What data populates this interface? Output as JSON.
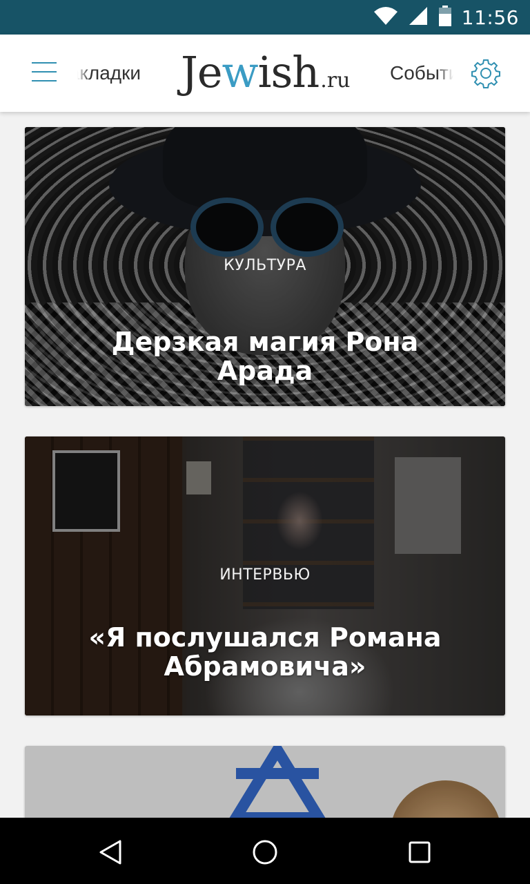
{
  "status_bar": {
    "time": "11:56",
    "icons": [
      "wifi-icon",
      "signal-icon",
      "battery-icon"
    ]
  },
  "app_bar": {
    "left_tab_label": "Закладки",
    "logo": {
      "main_start": "Je",
      "main_accent": "w",
      "main_end": "ish",
      "suffix": ".ru"
    },
    "right_tab_label": "События",
    "accent_color": "#3b9cc4"
  },
  "feed": {
    "cards": [
      {
        "category": "КУЛЬТУРА",
        "title": "Дерзкая магия Рона Арада"
      },
      {
        "category": "ИНТЕРВЬЮ",
        "title": "«Я послушался Романа Абрамовича»"
      },
      {
        "category": "",
        "title": ""
      }
    ]
  },
  "nav_bar": {
    "buttons": [
      "back-icon",
      "home-icon",
      "recents-icon"
    ]
  }
}
